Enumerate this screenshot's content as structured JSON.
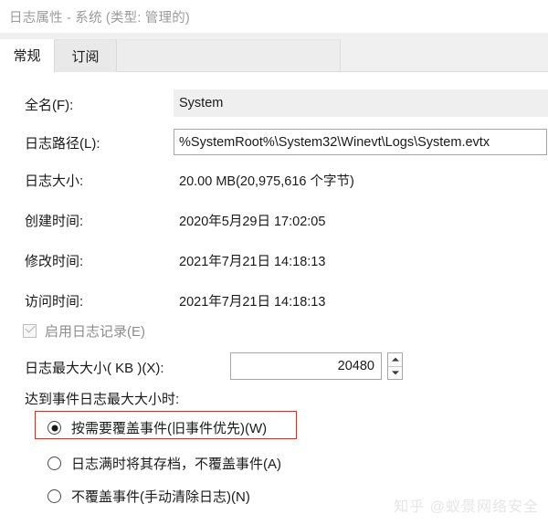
{
  "window": {
    "title": "日志属性 - 系统 (类型: 管理的)"
  },
  "tabs": [
    {
      "label": "常规",
      "active": true
    },
    {
      "label": "订阅",
      "active": false
    }
  ],
  "general": {
    "full_name": {
      "label": "全名(F):",
      "value": "System"
    },
    "log_path": {
      "label": "日志路径(L):",
      "value": "%SystemRoot%\\System32\\Winevt\\Logs\\System.evtx"
    },
    "log_size": {
      "label": "日志大小:",
      "value": "20.00 MB(20,975,616 个字节)"
    },
    "created": {
      "label": "创建时间:",
      "value": "2020年5月29日 17:02:05"
    },
    "modified": {
      "label": "修改时间:",
      "value": "2021年7月21日 14:18:13"
    },
    "accessed": {
      "label": "访问时间:",
      "value": "2021年7月21日 14:18:13"
    },
    "enable_logging": {
      "label": "启用日志记录(E)",
      "checked": true,
      "disabled": true
    },
    "max_log_size": {
      "label": "日志最大大小( KB )(X):",
      "value": "20480",
      "spinner_up": "▲",
      "spinner_down": "▼"
    },
    "when_max_reached": {
      "label": "达到事件日志最大大小时:",
      "options": [
        {
          "label": "按需要覆盖事件(旧事件优先)(W)",
          "selected": true,
          "highlighted": true
        },
        {
          "label": "日志满时将其存档，不覆盖事件(A)",
          "selected": false,
          "highlighted": false
        },
        {
          "label": "不覆盖事件(手动清除日志)(N)",
          "selected": false,
          "highlighted": false
        }
      ]
    }
  },
  "watermark": {
    "text": "知乎 @蚁景网络安全"
  },
  "colors": {
    "highlight_border": "#c0392b",
    "readonly_band": "#efefef",
    "tab_strip": "#f0f0f0",
    "title_text": "#9b9b9b"
  }
}
